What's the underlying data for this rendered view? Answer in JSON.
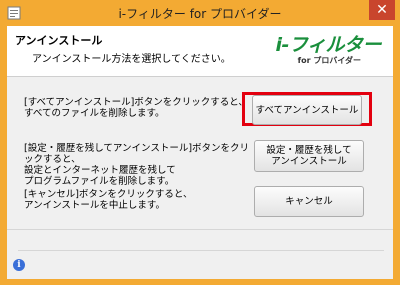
{
  "window": {
    "title": "i-フィルター for プロバイダー",
    "close_symbol": "✕"
  },
  "header": {
    "title": "アンインストール",
    "subtitle": "アンインストール方法を選択してください。",
    "logo_main": "i-フィルター",
    "logo_sub": "for プロバイダー"
  },
  "options": [
    {
      "desc_line1": "[すべてアンインストール]ボタンをクリックすると、",
      "desc_line2": "すべてのファイルを削除します。",
      "button_label": "すべてアンインストール"
    },
    {
      "desc_line1": "[設定・履歴を残してアンインストール]ボタンをクリックすると、",
      "desc_line2": "設定とインターネット履歴を残して",
      "desc_line3": "プログラムファイルを削除します。",
      "button_line1": "設定・履歴を残して",
      "button_line2": "アンインストール"
    },
    {
      "desc_line1": "[キャンセル]ボタンをクリックすると、",
      "desc_line2": "アンインストールを中止します。",
      "button_label": "キャンセル"
    }
  ],
  "footer": {
    "info_icon_glyph": "i"
  },
  "colors": {
    "frame": "#f3aa33",
    "close": "#c9452d",
    "highlight": "#e3000f",
    "logo": "#1a8f3c"
  }
}
